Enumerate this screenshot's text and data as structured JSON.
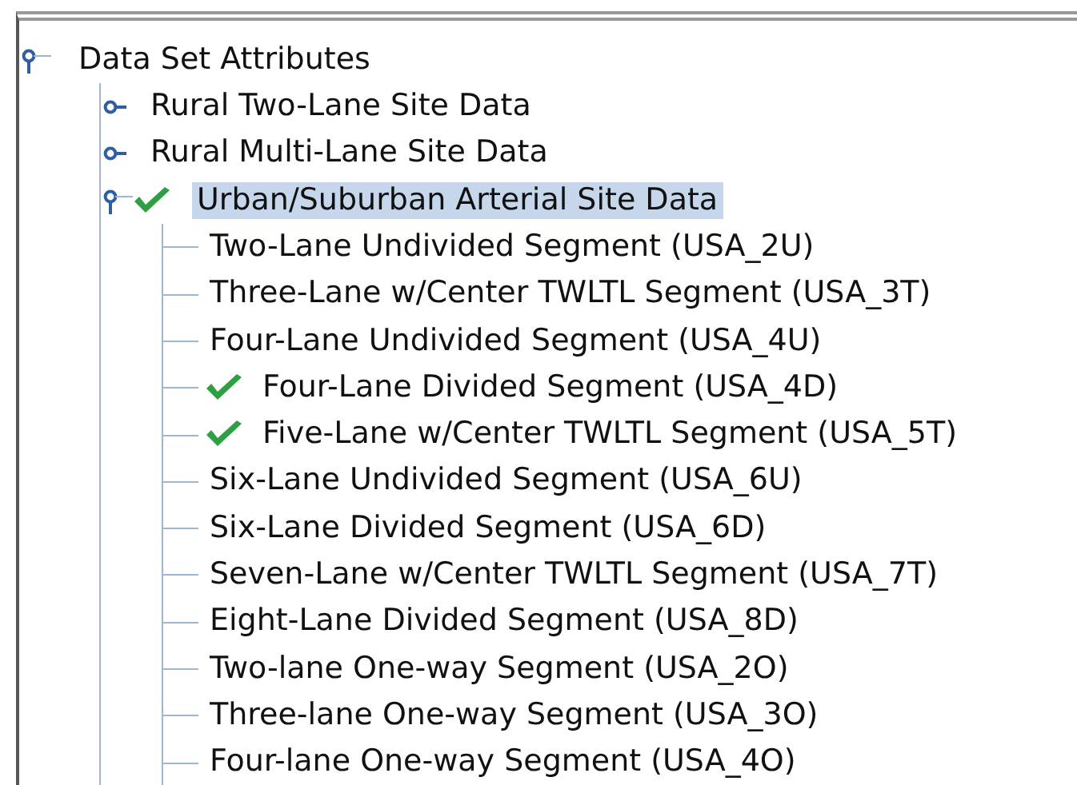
{
  "tree": {
    "label": "Data Set Attributes",
    "expanded": true,
    "checked": false,
    "selected": false,
    "children": [
      {
        "label": "Rural Two-Lane Site Data",
        "expanded": false,
        "checked": false,
        "selected": false
      },
      {
        "label": "Rural Multi-Lane Site Data",
        "expanded": false,
        "checked": false,
        "selected": false
      },
      {
        "label": "Urban/Suburban Arterial Site Data",
        "expanded": true,
        "checked": true,
        "selected": true,
        "children": [
          {
            "label": "Two-Lane Undivided Segment (USA_2U)",
            "checked": false,
            "selected": false
          },
          {
            "label": "Three-Lane w/Center TWLTL Segment (USA_3T)",
            "checked": false,
            "selected": false
          },
          {
            "label": "Four-Lane Undivided Segment (USA_4U)",
            "checked": false,
            "selected": false
          },
          {
            "label": "Four-Lane Divided Segment (USA_4D)",
            "checked": true,
            "selected": false
          },
          {
            "label": "Five-Lane w/Center TWLTL Segment (USA_5T)",
            "checked": true,
            "selected": false
          },
          {
            "label": "Six-Lane Undivided Segment (USA_6U)",
            "checked": false,
            "selected": false
          },
          {
            "label": "Six-Lane Divided Segment (USA_6D)",
            "checked": false,
            "selected": false
          },
          {
            "label": "Seven-Lane w/Center TWLTL Segment (USA_7T)",
            "checked": false,
            "selected": false
          },
          {
            "label": "Eight-Lane Divided Segment (USA_8D)",
            "checked": false,
            "selected": false
          },
          {
            "label": "Two-lane One-way Segment (USA_2O)",
            "checked": false,
            "selected": false
          },
          {
            "label": "Three-lane One-way Segment (USA_3O)",
            "checked": false,
            "selected": false
          },
          {
            "label": "Four-lane One-way Segment (USA_4O)",
            "checked": false,
            "selected": false
          }
        ]
      }
    ]
  }
}
